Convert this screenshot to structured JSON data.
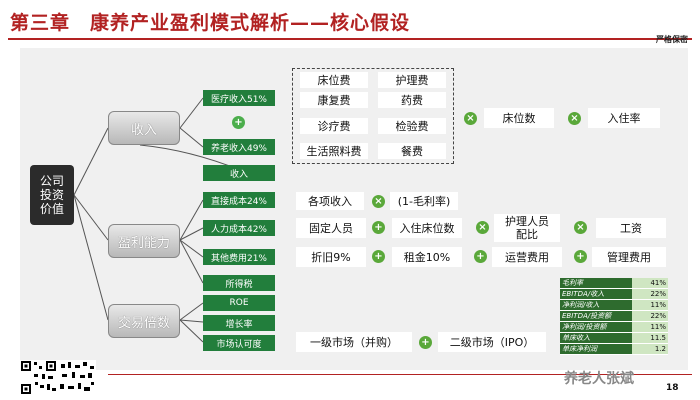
{
  "title": "第三章　康养产业盈利模式解析——核心假设",
  "confidential": "严格保密",
  "company_value": "公司\n投资\n价值",
  "categories": {
    "revenue": "收入",
    "profitability": "盈利能力",
    "multiple": "交易倍数"
  },
  "green": {
    "medical": "医疗收入51%",
    "elderly": "养老收入49%",
    "revenue": "收入",
    "direct_cost": "直接成本24%",
    "labor_cost": "人力成本42%",
    "other_cost": "其他费用21%",
    "income_tax": "所得税",
    "roe": "ROE",
    "growth": "增长率",
    "recognition": "市场认可度"
  },
  "fees": [
    "床位费",
    "护理费",
    "康复费",
    "药费",
    "诊疗费",
    "检验费",
    "生活照料费",
    "餐费"
  ],
  "revenue_chain": [
    "床位数",
    "入住率"
  ],
  "direct_chain": [
    "各项收入",
    "(1-毛利率)"
  ],
  "labor_chain": [
    "固定人员",
    "入住床位数",
    "护理人员\n配比",
    "工资"
  ],
  "other_chain": [
    "折旧9%",
    "租金10%",
    "运营费用",
    "管理费用"
  ],
  "market_chain": [
    "一级市场（并购）",
    "二级市场（IPO）"
  ],
  "stats_table": [
    {
      "label": "毛利率",
      "value": "41%"
    },
    {
      "label": "EBITDA/收入",
      "value": "22%"
    },
    {
      "label": "净利润/收入",
      "value": "11%"
    },
    {
      "label": "EBITDA/投资额",
      "value": "22%"
    },
    {
      "label": "净利润/投资额",
      "value": "11%"
    },
    {
      "label": "单床收入",
      "value": "11.5"
    },
    {
      "label": "单床净利润",
      "value": "1.2"
    }
  ],
  "watermark": "养老人张斌",
  "page_number": "18"
}
